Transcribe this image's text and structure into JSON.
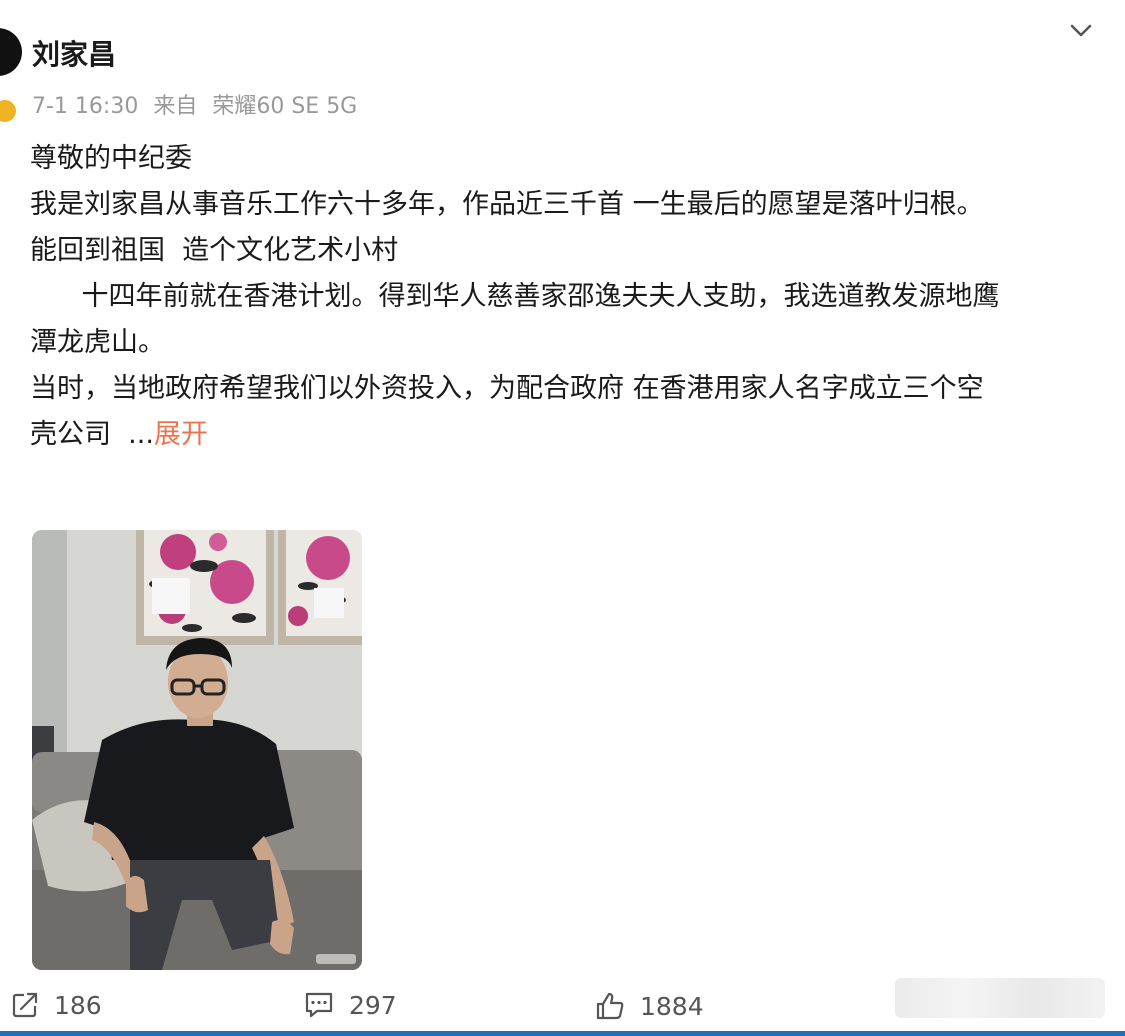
{
  "post": {
    "author": "刘家昌",
    "date": "7-1 16:30",
    "source_prefix": "来自",
    "source_device": "荣耀60 SE 5G",
    "lines": [
      "尊敬的中纪委",
      "我是刘家昌从事音乐工作六十多年，作品近三千首 一生最后的愿望是落叶归根。",
      "能回到祖国  造个文化艺术小村",
      "",
      "      十四年前就在香港计划。得到华人慈善家邵逸夫夫人支助，我选道教发源地鹰",
      "潭龙虎山。",
      "当时，当地政府希望我们以外资投入，为配合政府 在香港用家人名字成立三个空",
      "壳公司  ..."
    ],
    "expand_label": "展开"
  },
  "actions": {
    "repost_count": "186",
    "comment_count": "297",
    "like_count": "1884"
  },
  "icons": {
    "menu": "chevron-down-icon",
    "repost": "repost-icon",
    "comment": "comment-icon",
    "like": "thumbs-up-icon"
  },
  "colors": {
    "expand": "#eb7350",
    "meta": "#999999",
    "verified_badge": "#f0b323"
  }
}
